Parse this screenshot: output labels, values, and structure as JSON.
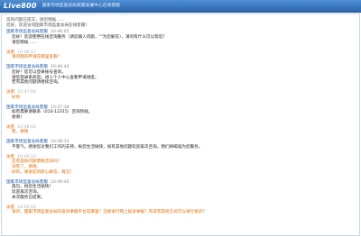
{
  "header": {
    "logo": "Live800",
    "title": "国家市场监督总局质量发展中心在线客服"
  },
  "system": {
    "line1": "您的问题已提交，请您稍候……",
    "line2": "您好，欢迎访问国家市场监督总局在线客服！"
  },
  "messages": [
    {
      "role": "agent",
      "name": "国家市场监督总局客服",
      "time": "10:46:05",
      "lines": [
        "您好！欢迎使用在线咨询服务（请您输入问题，\"\"为您解答），请问有什么可以帮您？",
        "请您稍候……"
      ]
    },
    {
      "role": "user",
      "name": "访客",
      "time": "10:46:17",
      "lines": [
        "请问我的申请在哪里查看？"
      ]
    },
    {
      "role": "agent",
      "name": "国家市场监督总局客服",
      "time": "10:46:44",
      "lines": [
        "您好！您可以登录账号查询，",
        "请您登录系统后，进入个人中心查看申请进度。",
        "若有其他问题请继续咨询。"
      ]
    },
    {
      "role": "user",
      "name": "访客",
      "time": "10:47:06",
      "lines": [
        "好的"
      ]
    },
    {
      "role": "agent",
      "name": "国家市场监督总局客服",
      "time": "10:47:38",
      "lines": [
        "如有需要请联系（010-12315）咨询热线。",
        "谢谢！"
      ]
    },
    {
      "role": "user",
      "name": "访客",
      "time": "10:48:02",
      "lines": [
        "嗯，谢谢"
      ]
    },
    {
      "role": "agent",
      "name": "国家市场监督总局客服",
      "time": "10:48:33",
      "lines": [
        "不客气，感谢您对我们工作的支持，祝您生活愉快，如有其他问题欢迎再次咨询，我们将竭诚为您服务。"
      ]
    },
    {
      "role": "user",
      "name": "访客",
      "time": "10:49:10",
      "lines": [
        "还有其他问题需要咨询吗？",
        "没有了，谢谢。",
        "好的，谢谢您的耐心解答，再见！"
      ]
    },
    {
      "role": "agent",
      "name": "国家市场监督总局客服",
      "time": "10:49:40",
      "lines": [
        "再见，祝您生活愉快！",
        "欢迎再次咨询。",
        "本次服务已结束。"
      ]
    },
    {
      "role": "user",
      "name": "访客",
      "time": "10:50:03",
      "lines": [
        "请问，国家市场监督总局的投诉举报平台在哪里？怎样进行网上投诉举报？有没有其他方式可以进行投诉？"
      ]
    }
  ]
}
